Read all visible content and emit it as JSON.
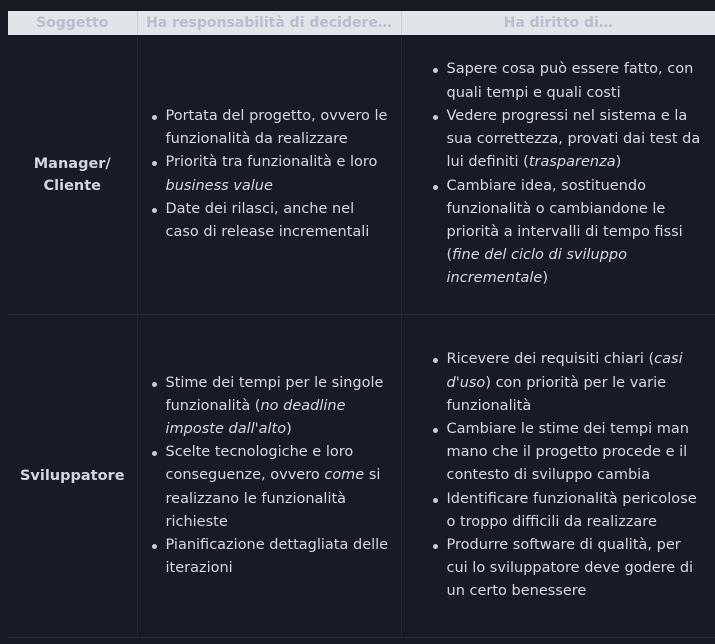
{
  "table": {
    "headers": [
      "Soggetto",
      "Ha responsabilità di decidere…",
      "Ha diritto di…"
    ],
    "rows": [
      {
        "subject": "Manager/\nCliente",
        "responsibilities": [
          [
            {
              "t": "Portata del progetto, ovvero le funzionalità da realizzare"
            }
          ],
          [
            {
              "t": "Priorità tra funzionalità e loro "
            },
            {
              "t": "business value",
              "em": true
            }
          ],
          [
            {
              "t": "Date dei rilasci, anche nel caso di release incrementali"
            }
          ]
        ],
        "rights": [
          [
            {
              "t": "Sapere cosa può essere fatto, con quali tempi e quali costi"
            }
          ],
          [
            {
              "t": "Vedere progressi nel sistema e la sua correttezza, provati dai test da lui definiti ("
            },
            {
              "t": "trasparenza",
              "em": true
            },
            {
              "t": ")"
            }
          ],
          [
            {
              "t": "Cambiare idea, sostituendo funzionalità o cambiandone le priorità a intervalli di tempo fissi ("
            },
            {
              "t": "fine del ciclo di sviluppo incrementale",
              "em": true
            },
            {
              "t": ")"
            }
          ]
        ]
      },
      {
        "subject": "Sviluppatore",
        "responsibilities": [
          [
            {
              "t": "Stime dei tempi per le singole funzionalità ("
            },
            {
              "t": "no deadline imposte dall'alto",
              "em": true
            },
            {
              "t": ")"
            }
          ],
          [
            {
              "t": "Scelte tecnologiche e loro conseguenze, ovvero "
            },
            {
              "t": "come",
              "em": true
            },
            {
              "t": " si realizzano le funzionalità richieste"
            }
          ],
          [
            {
              "t": "Pianificazione dettagliata delle iterazioni"
            }
          ]
        ],
        "rights": [
          [
            {
              "t": "Ricevere dei requisiti chiari ("
            },
            {
              "t": "casi d'uso",
              "em": true
            },
            {
              "t": ") con priorità per le varie funzionalità"
            }
          ],
          [
            {
              "t": "Cambiare le stime dei tempi man mano che il progetto procede e il contesto di sviluppo cambia"
            }
          ],
          [
            {
              "t": "Identificare funzionalità pericolose o troppo difficili da realizzare"
            }
          ],
          [
            {
              "t": "Produrre software di qualità, per cui lo sviluppatore deve godere di un certo benessere"
            }
          ]
        ]
      }
    ]
  }
}
